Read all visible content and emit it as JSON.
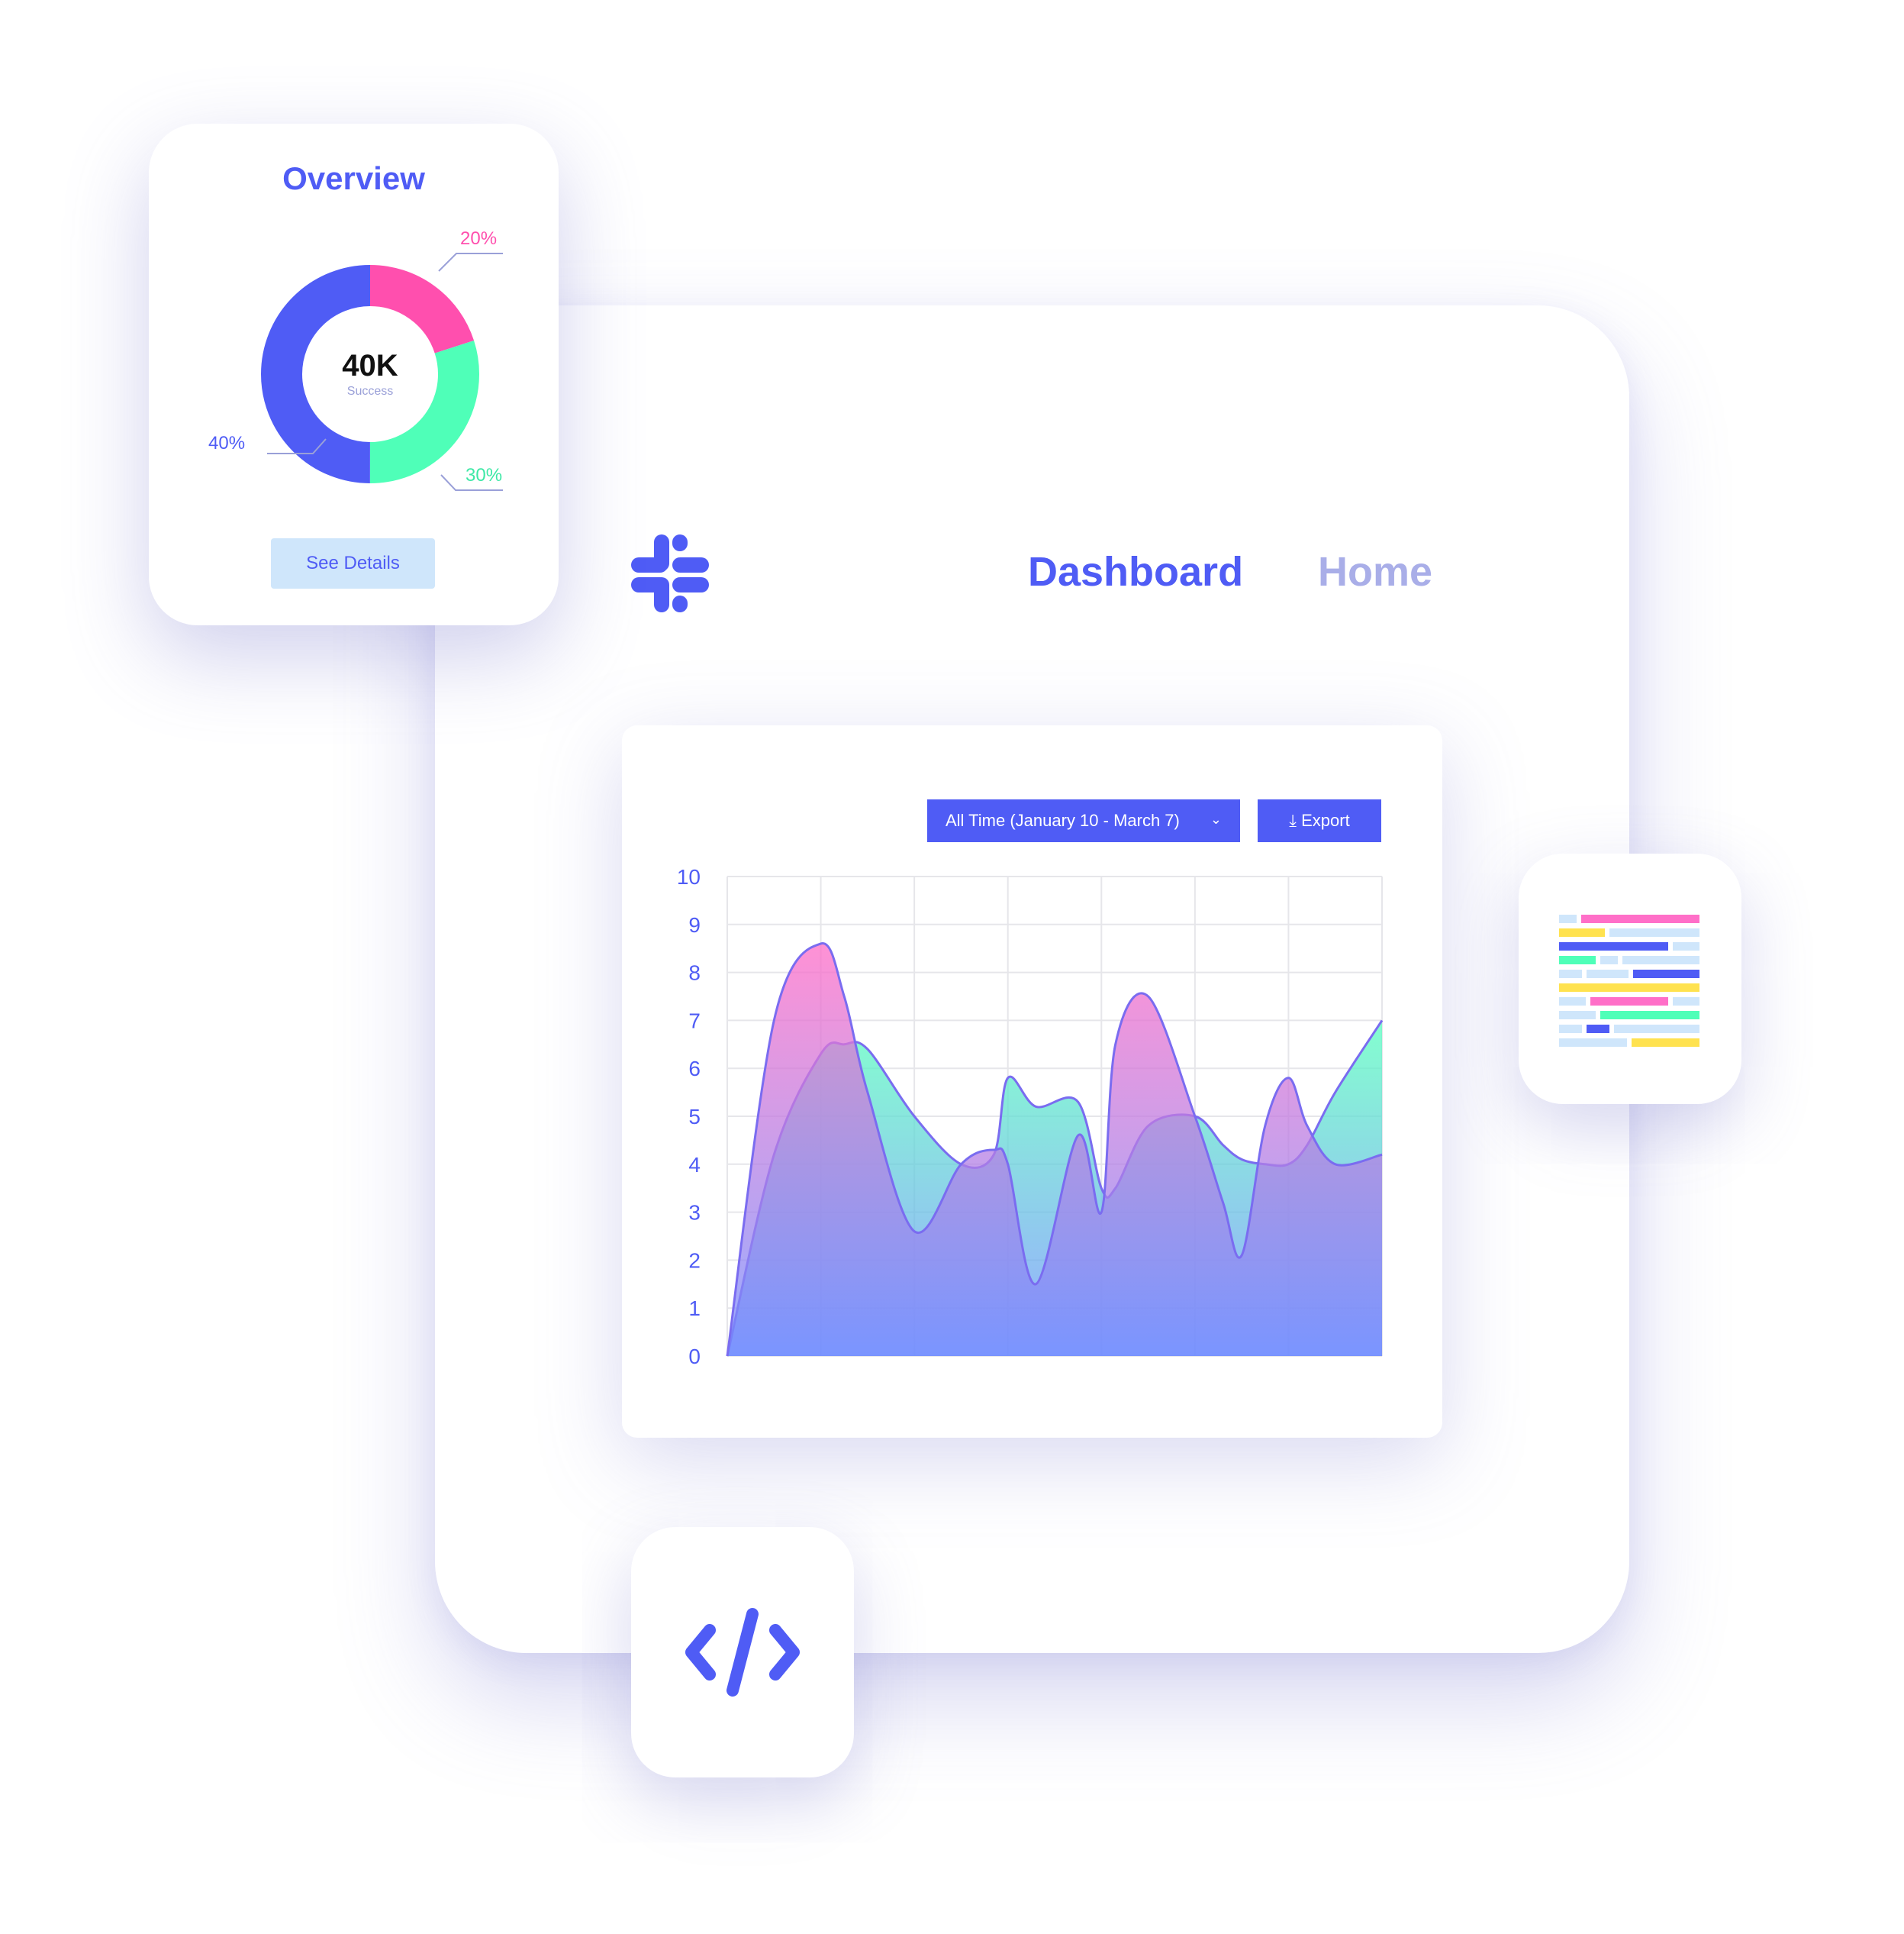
{
  "overview": {
    "title": "Overview",
    "center_value": "40K",
    "center_label": "Success",
    "button_label": "See Details",
    "segments": [
      {
        "label": "20%",
        "value": 20,
        "color": "#ff4fae"
      },
      {
        "label": "30%",
        "value": 30,
        "color": "#4fffb8"
      },
      {
        "label": "40%",
        "value": 40,
        "color": "#4f5cf5"
      }
    ]
  },
  "nav": {
    "dashboard": "Dashboard",
    "home": "Home"
  },
  "toolbar": {
    "range_label": "All Time (January 10 - March 7)",
    "export_label": "Export"
  },
  "colors": {
    "accent": "#4f5cf5",
    "pink": "#ff4fae",
    "green": "#4fffb8",
    "light_blue": "#cfe6fb",
    "yellow": "#ffe24f"
  },
  "chart_data": {
    "type": "area",
    "ylim": [
      0,
      10
    ],
    "yticks": [
      0,
      1,
      2,
      3,
      4,
      5,
      6,
      7,
      8,
      9,
      10
    ],
    "x": [
      0,
      0.5,
      1,
      1.25,
      1.5,
      2,
      2.5,
      2.85,
      3,
      3.3,
      3.75,
      4,
      4.15,
      4.5,
      5,
      5.3,
      5.5,
      5.75,
      6,
      6.2,
      6.5,
      7
    ],
    "series": [
      {
        "color": "#ff6fc8",
        "values": [
          0,
          7,
          8.6,
          7.5,
          5.5,
          2.6,
          4,
          4.3,
          4,
          1.5,
          4.6,
          3,
          6.5,
          7.5,
          5,
          3.2,
          2.1,
          4.8,
          5.8,
          4.8,
          4,
          4.2
        ]
      },
      {
        "color": "#5dffc0",
        "values": [
          0,
          4.2,
          6.3,
          6.5,
          6.4,
          5,
          4,
          4.2,
          5.8,
          5.2,
          5.3,
          3.5,
          3.5,
          4.8,
          5,
          4.4,
          4.1,
          4,
          4,
          4.4,
          5.5,
          7
        ]
      }
    ]
  }
}
